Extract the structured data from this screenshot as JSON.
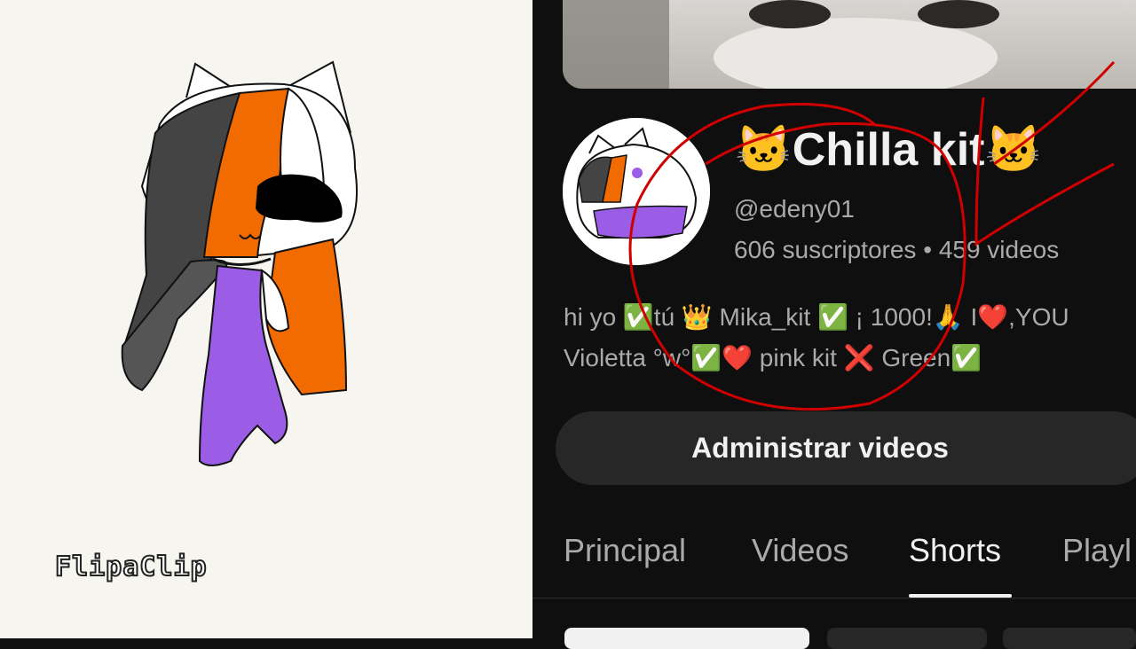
{
  "canvas": {
    "app_logo_text": "FlipaClip"
  },
  "channel": {
    "name": "🐱Chilla kit🐱",
    "handle": "@edeny01",
    "subscribers": "606 suscriptores",
    "separator": "•",
    "videos": "459 videos",
    "description_line1": "hi yo ✅tú 👑 Mika_kit ✅ ¡ 1000!🙏 I❤️,YOU",
    "description_line2": "Violetta °w°✅❤️  pink kit ❌  Green✅"
  },
  "actions": {
    "manage_videos": "Administrar videos"
  },
  "tabs": [
    {
      "label": "Principal",
      "active": false
    },
    {
      "label": "Videos",
      "active": false
    },
    {
      "label": "Shorts",
      "active": true
    },
    {
      "label": "Playl",
      "active": false
    }
  ],
  "colors": {
    "background": "#0f0f0f",
    "text_primary": "#f1f1f1",
    "text_secondary": "#aaaaaa",
    "button_bg": "#272727",
    "annotation_red": "#d00000",
    "orange": "#f26b00",
    "purple": "#9b5de5"
  }
}
